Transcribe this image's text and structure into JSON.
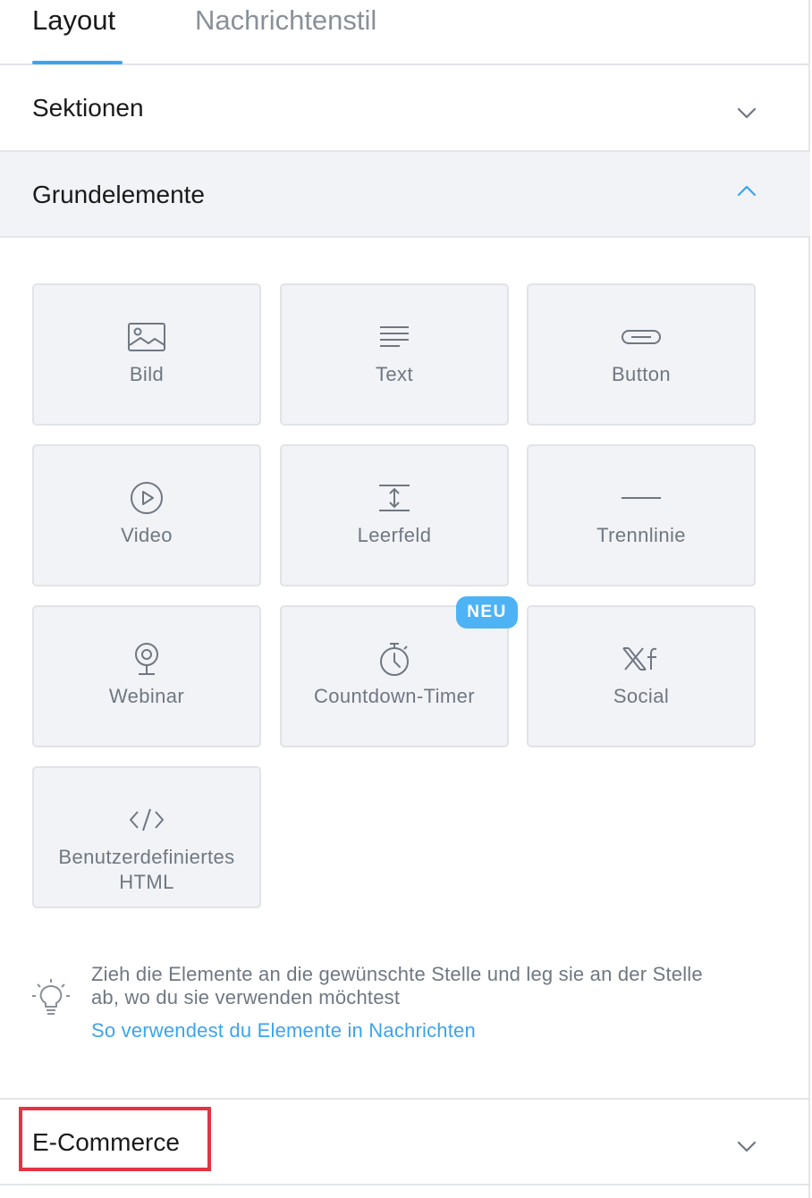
{
  "tabs": [
    {
      "label": "Layout",
      "active": true
    },
    {
      "label": "Nachrichtenstil",
      "active": false
    }
  ],
  "sections": {
    "sektionen": {
      "title": "Sektionen",
      "expanded": false,
      "icon": "chevron-down-icon"
    },
    "grundelemente": {
      "title": "Grundelemente",
      "expanded": true,
      "icon": "chevron-up-icon"
    },
    "ecommerce": {
      "title": "E-Commerce",
      "expanded": false,
      "icon": "chevron-down-icon",
      "highlighted": true
    }
  },
  "elements": [
    {
      "label": "Bild",
      "icon": "image-icon"
    },
    {
      "label": "Text",
      "icon": "text-lines-icon"
    },
    {
      "label": "Button",
      "icon": "button-icon"
    },
    {
      "label": "Video",
      "icon": "play-circle-icon"
    },
    {
      "label": "Leerfeld",
      "icon": "spacer-icon"
    },
    {
      "label": "Trennlinie",
      "icon": "divider-icon"
    },
    {
      "label": "Webinar",
      "icon": "webcam-icon"
    },
    {
      "label": "Countdown-Timer",
      "icon": "stopwatch-icon",
      "badge": "NEU"
    },
    {
      "label": "Social",
      "icon": "social-x-facebook-icon"
    },
    {
      "label": "Benutzerdefiniertes HTML",
      "icon": "code-icon"
    }
  ],
  "hint": {
    "icon": "lightbulb-icon",
    "text": "Zieh die Elemente an die gewünschte Stelle und leg sie an der Stelle ab, wo du sie verwenden möchtest",
    "link": "So verwendest du Elemente in Nachrichten"
  },
  "colors": {
    "accent": "#3aa4f0",
    "badge": "#4db3f5",
    "highlight": "#e53343",
    "tile_bg": "#f2f3f6",
    "muted_text": "#6f7782"
  }
}
